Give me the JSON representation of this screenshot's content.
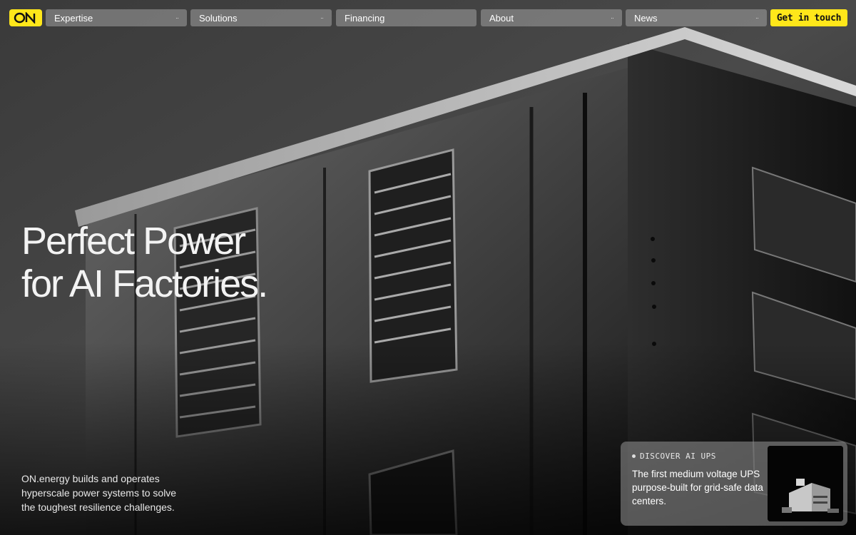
{
  "brand": {
    "logo_text": "ON",
    "accent": "#ffe71a"
  },
  "nav": {
    "items": [
      {
        "label": "Expertise",
        "has_menu": true
      },
      {
        "label": "Solutions",
        "has_menu": true
      },
      {
        "label": "Financing",
        "has_menu": false
      },
      {
        "label": "About",
        "has_menu": true
      },
      {
        "label": "News",
        "has_menu": true
      }
    ],
    "chevron": "··",
    "cta_label": "Get in touch"
  },
  "hero": {
    "headline_line1": "Perfect Power",
    "headline_line2": "for AI Factories.",
    "subtext": "ON.energy builds and operates hyperscale power systems to solve the toughest resilience challenges."
  },
  "card": {
    "eyebrow": "DISCOVER AI UPS",
    "text": "The first medium voltage UPS purpose-built for grid-safe data centers."
  }
}
